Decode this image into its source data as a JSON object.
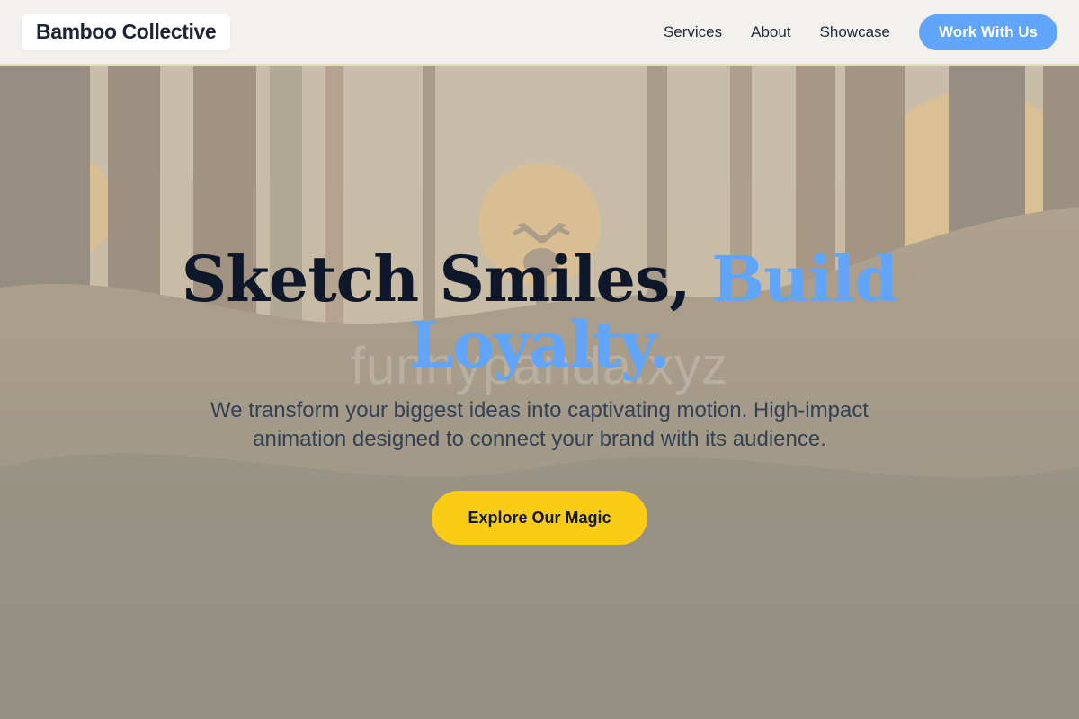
{
  "header": {
    "brand": "Bamboo Collective",
    "nav": [
      {
        "label": "Services"
      },
      {
        "label": "About"
      },
      {
        "label": "Showcase"
      }
    ],
    "cta_label": "Work With Us"
  },
  "hero": {
    "watermark": "funnypanda.xyz",
    "headline_part1": "Sketch Smiles,",
    "headline_part2": "Build Loyalty.",
    "subtitle": "We transform your biggest ideas into captivating motion. High-impact animation designed to connect your brand with its audience.",
    "cta_label": "Explore Our Magic",
    "background_icon": "forest-sunset-deer-illustration"
  },
  "colors": {
    "accent_blue": "#60a5fa",
    "cta_yellow": "#facc15",
    "headline_dark": "#0f172a",
    "body_slate": "#334155",
    "nav_bg": "#f2f1ee"
  }
}
